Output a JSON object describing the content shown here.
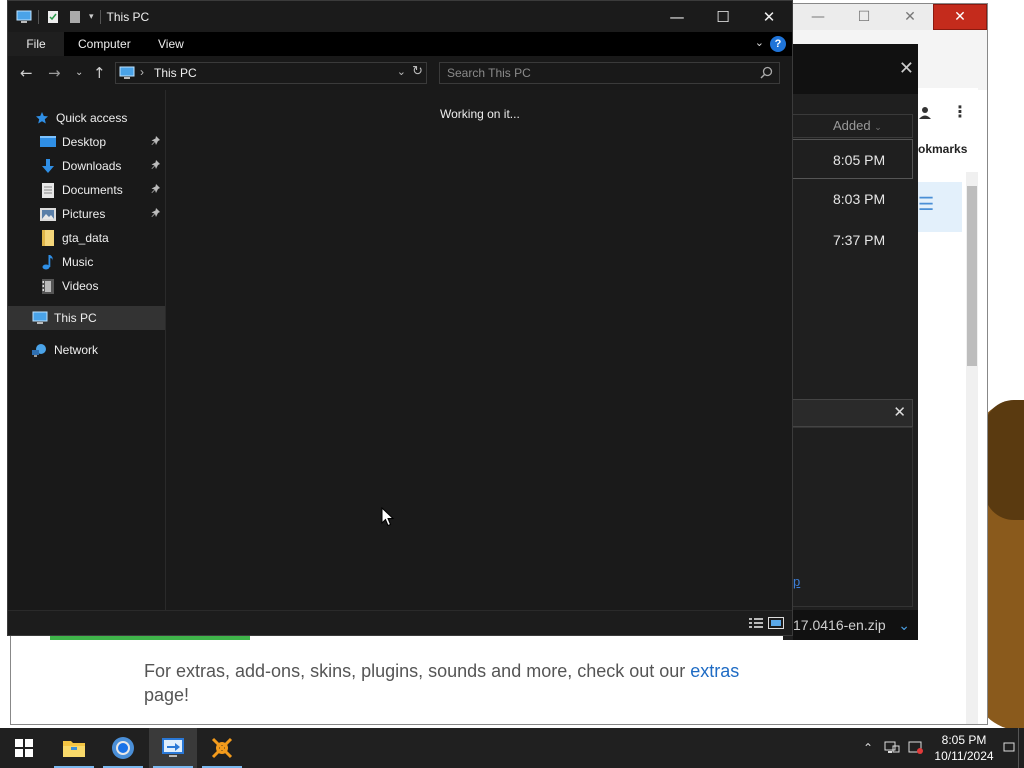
{
  "explorer": {
    "title": "This PC",
    "window_buttons": {
      "minimize": "—",
      "maximize": "☐",
      "close": "✕"
    },
    "ribbon": {
      "file": "File",
      "computer": "Computer",
      "view": "View",
      "help": "?"
    },
    "address": {
      "path": "This PC"
    },
    "search": {
      "placeholder": "Search This PC"
    },
    "nav": {
      "quick_access": "Quick access",
      "items": [
        {
          "label": "Desktop",
          "icon": "desktop-icon",
          "pinned": true
        },
        {
          "label": "Downloads",
          "icon": "downloads-icon",
          "pinned": true
        },
        {
          "label": "Documents",
          "icon": "documents-icon",
          "pinned": true
        },
        {
          "label": "Pictures",
          "icon": "pictures-icon",
          "pinned": true
        },
        {
          "label": "gta_data",
          "icon": "folder-icon",
          "pinned": false
        },
        {
          "label": "Music",
          "icon": "music-icon",
          "pinned": false
        },
        {
          "label": "Videos",
          "icon": "videos-icon",
          "pinned": false
        }
      ],
      "this_pc": "This PC",
      "network": "Network"
    },
    "content": {
      "status_message": "Working on it..."
    }
  },
  "browser": {
    "downloads": {
      "column_added": "Added",
      "rows": [
        {
          "time": "8:05 PM"
        },
        {
          "time": "8:03 PM"
        },
        {
          "time": "7:37 PM"
        }
      ],
      "link_fragment": "p",
      "file_name": "17.0416-en.zip"
    },
    "side": {
      "bookmarks": "okmarks"
    },
    "page": {
      "text_before_link": "For extras, add-ons, skins, plugins, sounds and more, check out our ",
      "link": "extras",
      "text_after_link": "page!"
    }
  },
  "taskbar": {
    "clock": {
      "time": "8:05 PM",
      "date": "10/11/2024"
    },
    "apps": [
      "file-explorer",
      "chrome",
      "remote-desktop",
      "app-orange"
    ]
  },
  "colors": {
    "explorer_bg": "#191919",
    "selected_nav": "#333333",
    "accent": "#1f74d9",
    "taskbar": "#202020",
    "progress": "#3fb44a"
  }
}
